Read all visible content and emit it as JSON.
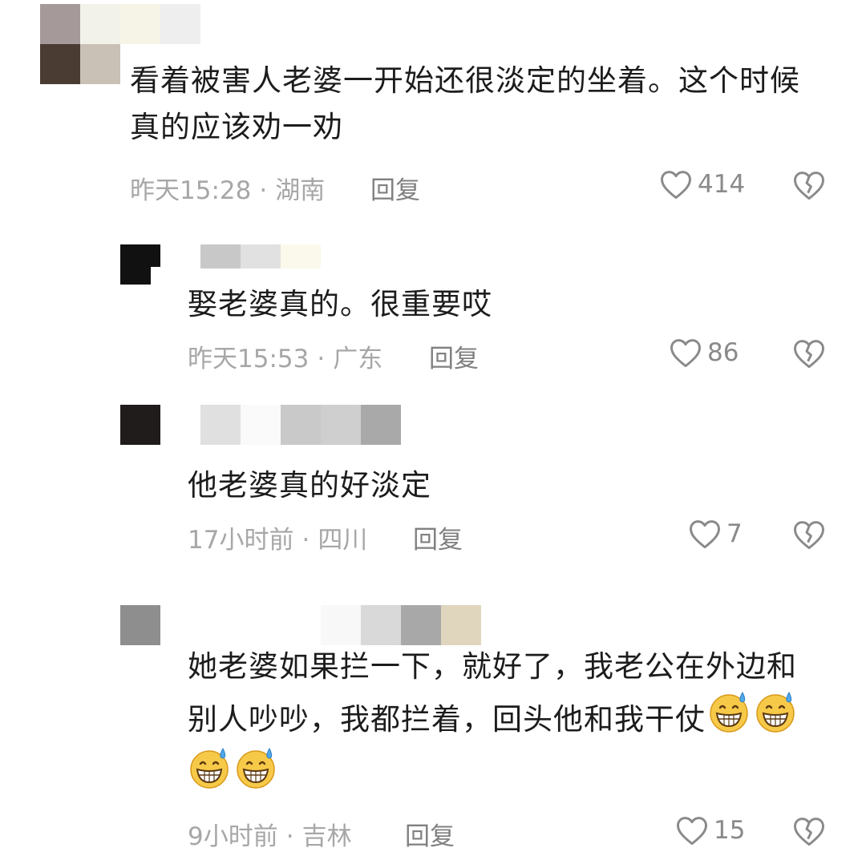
{
  "comments": [
    {
      "text_lines": [
        "看着被害人老婆一开始还很淡定的坐着。这个时候",
        "真的应该劝一劝"
      ],
      "time": "昨天15:28",
      "location": "湖南",
      "reply_label": "回复",
      "likes": "414"
    },
    {
      "text_lines": [
        "娶老婆真的。很重要哎"
      ],
      "time": "昨天15:53",
      "location": "广东",
      "reply_label": "回复",
      "likes": "86"
    },
    {
      "text_lines": [
        "他老婆真的好淡定"
      ],
      "time": "17小时前",
      "location": "四川",
      "reply_label": "回复",
      "likes": "7"
    },
    {
      "text_lines": [
        "她老婆如果拦一下，就好了，我老公在外边和",
        "别人吵吵，我都拦着，回头他和我干仗"
      ],
      "emoji": "grinning-sweat-emoji",
      "time": "9小时前",
      "location": "吉林",
      "reply_label": "回复",
      "likes": "15"
    }
  ],
  "separator": "·",
  "icons": {
    "like": "heart-outline-icon",
    "dislike": "broken-heart-icon"
  }
}
